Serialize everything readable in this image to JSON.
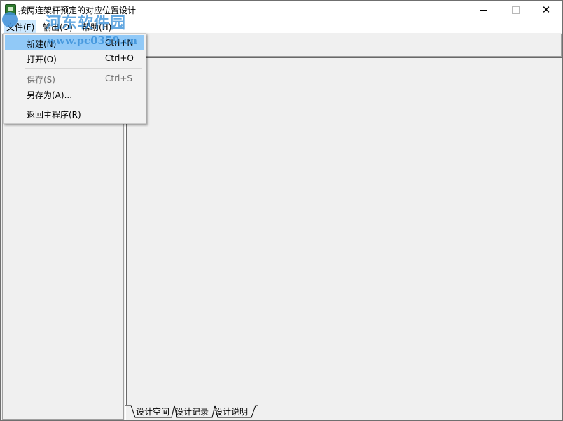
{
  "window": {
    "title": "按两连架杆预定的对应位置设计",
    "controls": {
      "close": "✕"
    }
  },
  "watermark": {
    "brand_cn": "河东软件园",
    "url": "www.pc0359.cn"
  },
  "menubar": {
    "items": [
      {
        "label": "文件(F)"
      },
      {
        "label": "输出(O)"
      },
      {
        "label": "帮助(H)"
      }
    ]
  },
  "file_menu": {
    "items": [
      {
        "label": "新建(N)",
        "shortcut": "Ctrl+N",
        "highlighted": true,
        "enabled": true
      },
      {
        "label": "打开(O)",
        "shortcut": "Ctrl+O",
        "enabled": true
      },
      {
        "label": "保存(S)",
        "shortcut": "Ctrl+S",
        "enabled": false
      },
      {
        "label": "另存为(A)...",
        "shortcut": "",
        "enabled": true
      },
      {
        "label": "返回主程序(R)",
        "shortcut": "",
        "enabled": true
      }
    ]
  },
  "tabs": [
    {
      "label": "设计空间",
      "active": true
    },
    {
      "label": "设计记录"
    },
    {
      "label": "设计说明"
    }
  ],
  "colors": {
    "menu_highlight": "#91c9f7",
    "menubar_selected": "#cce8ff",
    "watermark": "#2f8ad6"
  }
}
